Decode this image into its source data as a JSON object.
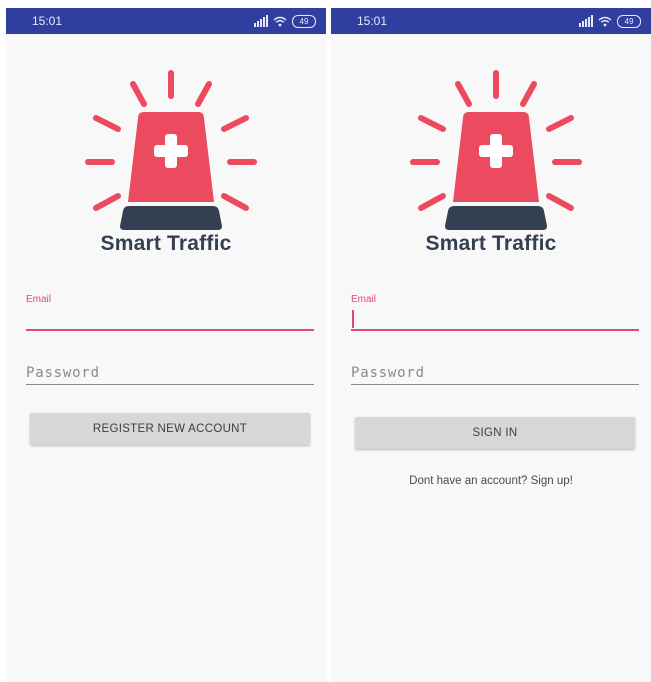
{
  "colors": {
    "status_bar": "#303f9f",
    "accent": "#e0457b",
    "logo_red": "#ec4a5e",
    "logo_dark": "#353f52",
    "button_bg": "#d6d7d8",
    "screen_bg": "#f8f8f9"
  },
  "screens": [
    {
      "status_bar": {
        "time": "15:01",
        "battery": "49",
        "icons": [
          "signal-icon",
          "wifi-icon",
          "battery-icon"
        ]
      },
      "logo": {
        "icon": "siren-medical-cross-icon",
        "title": "Smart Traffic"
      },
      "email": {
        "label": "Email",
        "value": ""
      },
      "password": {
        "placeholder": "Password",
        "value": ""
      },
      "primary_button": "REGISTER NEW ACCOUNT"
    },
    {
      "status_bar": {
        "time": "15:01",
        "battery": "49",
        "icons": [
          "signal-icon",
          "wifi-icon",
          "battery-icon"
        ]
      },
      "logo": {
        "icon": "siren-medical-cross-icon",
        "title": "Smart Traffic"
      },
      "email": {
        "label": "Email",
        "value": ""
      },
      "password": {
        "placeholder": "Password",
        "value": ""
      },
      "primary_button": "SIGN IN",
      "footer_link": "Dont have an account? Sign up!"
    }
  ]
}
